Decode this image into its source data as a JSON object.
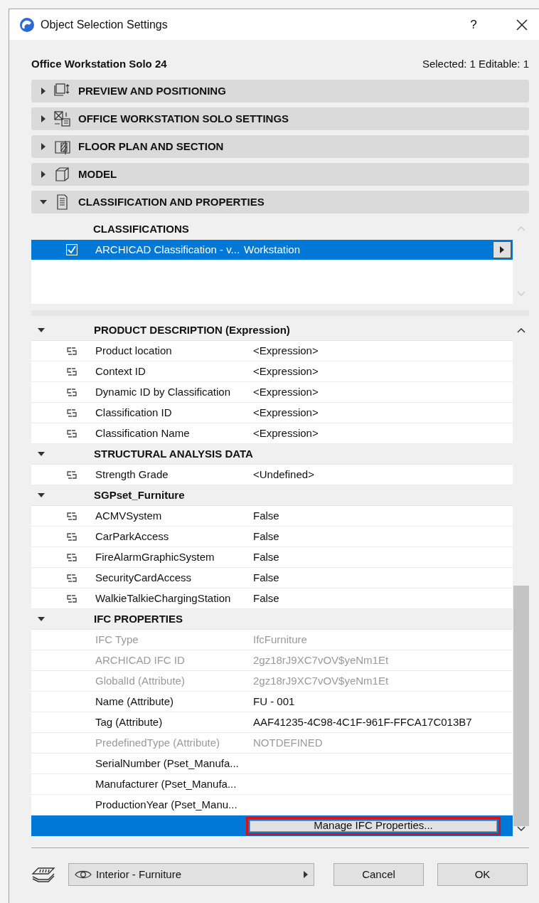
{
  "window": {
    "title": "Object Selection Settings",
    "help": "?"
  },
  "header": {
    "object_name": "Office Workstation Solo 24",
    "selection_info": "Selected: 1 Editable: 1"
  },
  "sections": [
    {
      "kind": "preview",
      "label": "PREVIEW AND POSITIONING",
      "expanded": false
    },
    {
      "kind": "settings",
      "label": "OFFICE WORKSTATION SOLO SETTINGS",
      "expanded": false
    },
    {
      "kind": "floorplan",
      "label": "FLOOR PLAN AND SECTION",
      "expanded": false
    },
    {
      "kind": "model",
      "label": "MODEL",
      "expanded": false
    },
    {
      "kind": "classification",
      "label": "CLASSIFICATION AND PROPERTIES",
      "expanded": true
    }
  ],
  "classifications": {
    "heading": "CLASSIFICATIONS",
    "rows": [
      {
        "name": "ARCHICAD Classification - v...",
        "value": "Workstation",
        "checked": true,
        "selected": true
      }
    ]
  },
  "property_groups": [
    {
      "title": "PRODUCT DESCRIPTION (Expression)",
      "expanded": true,
      "rows": [
        {
          "kind": "linked",
          "name": "Product location",
          "value": "<Expression>",
          "disabled": false
        },
        {
          "kind": "linked",
          "name": "Context ID",
          "value": "<Expression>",
          "disabled": false
        },
        {
          "kind": "linked",
          "name": "Dynamic ID by Classification",
          "value": "<Expression>",
          "disabled": false
        },
        {
          "kind": "linked",
          "name": "Classification ID",
          "value": "<Expression>",
          "disabled": false
        },
        {
          "kind": "linked",
          "name": "Classification Name",
          "value": "<Expression>",
          "disabled": false
        }
      ]
    },
    {
      "title": "STRUCTURAL ANALYSIS DATA",
      "expanded": true,
      "rows": [
        {
          "kind": "linked",
          "name": "Strength Grade",
          "value": "<Undefined>",
          "disabled": false
        }
      ]
    },
    {
      "title": "SGPset_Furniture",
      "expanded": true,
      "rows": [
        {
          "kind": "linked",
          "name": "ACMVSystem",
          "value": "False",
          "disabled": false
        },
        {
          "kind": "linked",
          "name": "CarParkAccess",
          "value": "False",
          "disabled": false
        },
        {
          "kind": "linked",
          "name": "FireAlarmGraphicSystem",
          "value": "False",
          "disabled": false
        },
        {
          "kind": "linked",
          "name": "SecurityCardAccess",
          "value": "False",
          "disabled": false
        },
        {
          "kind": "linked",
          "name": "WalkieTalkieChargingStation",
          "value": "False",
          "disabled": false
        }
      ]
    },
    {
      "title": "IFC PROPERTIES",
      "expanded": true,
      "rows": [
        {
          "kind": "plain",
          "name": "IFC Type",
          "value": "IfcFurniture",
          "disabled": true
        },
        {
          "kind": "plain",
          "name": "ARCHICAD IFC ID",
          "value": "2gz18rJ9XC7vOV$yeNm1Et",
          "disabled": true
        },
        {
          "kind": "plain",
          "name": "GlobalId (Attribute)",
          "value": "2gz18rJ9XC7vOV$yeNm1Et",
          "disabled": true
        },
        {
          "kind": "plain",
          "name": "Name (Attribute)",
          "value": "FU - 001",
          "disabled": false
        },
        {
          "kind": "plain",
          "name": "Tag (Attribute)",
          "value": "AAF41235-4C98-4C1F-961F-FFCA17C013B7",
          "disabled": false
        },
        {
          "kind": "plain",
          "name": "PredefinedType (Attribute)",
          "value": "NOTDEFINED",
          "disabled": true
        },
        {
          "kind": "plain",
          "name": "SerialNumber (Pset_Manufa...",
          "disabled": false
        },
        {
          "kind": "plain",
          "name": "Manufacturer (Pset_Manufa...",
          "disabled": false
        },
        {
          "kind": "plain",
          "name": "ProductionYear (Pset_Manu...",
          "disabled": false
        }
      ]
    }
  ],
  "manage_button": {
    "label": "Manage IFC Properties...",
    "highlighted": true
  },
  "footer": {
    "layer": "Interior - Furniture",
    "buttons": [
      "Cancel",
      "OK"
    ]
  }
}
